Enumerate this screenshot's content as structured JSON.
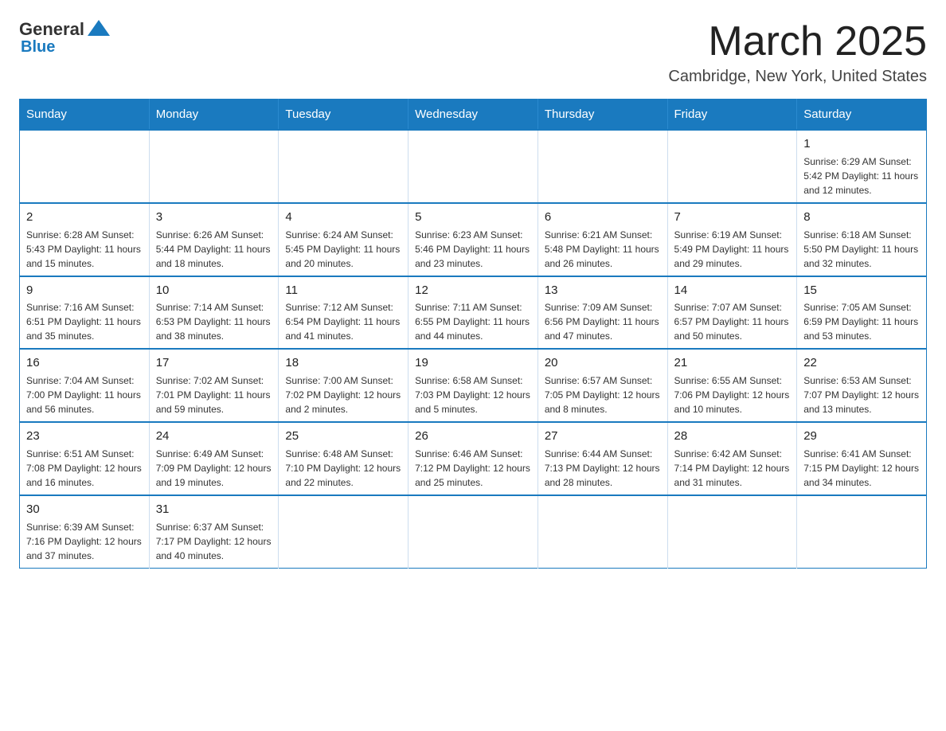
{
  "logo": {
    "general": "General",
    "blue": "Blue"
  },
  "header": {
    "month": "March 2025",
    "location": "Cambridge, New York, United States"
  },
  "weekdays": [
    "Sunday",
    "Monday",
    "Tuesday",
    "Wednesday",
    "Thursday",
    "Friday",
    "Saturday"
  ],
  "weeks": [
    [
      {
        "day": "",
        "info": ""
      },
      {
        "day": "",
        "info": ""
      },
      {
        "day": "",
        "info": ""
      },
      {
        "day": "",
        "info": ""
      },
      {
        "day": "",
        "info": ""
      },
      {
        "day": "",
        "info": ""
      },
      {
        "day": "1",
        "info": "Sunrise: 6:29 AM\nSunset: 5:42 PM\nDaylight: 11 hours and 12 minutes."
      }
    ],
    [
      {
        "day": "2",
        "info": "Sunrise: 6:28 AM\nSunset: 5:43 PM\nDaylight: 11 hours and 15 minutes."
      },
      {
        "day": "3",
        "info": "Sunrise: 6:26 AM\nSunset: 5:44 PM\nDaylight: 11 hours and 18 minutes."
      },
      {
        "day": "4",
        "info": "Sunrise: 6:24 AM\nSunset: 5:45 PM\nDaylight: 11 hours and 20 minutes."
      },
      {
        "day": "5",
        "info": "Sunrise: 6:23 AM\nSunset: 5:46 PM\nDaylight: 11 hours and 23 minutes."
      },
      {
        "day": "6",
        "info": "Sunrise: 6:21 AM\nSunset: 5:48 PM\nDaylight: 11 hours and 26 minutes."
      },
      {
        "day": "7",
        "info": "Sunrise: 6:19 AM\nSunset: 5:49 PM\nDaylight: 11 hours and 29 minutes."
      },
      {
        "day": "8",
        "info": "Sunrise: 6:18 AM\nSunset: 5:50 PM\nDaylight: 11 hours and 32 minutes."
      }
    ],
    [
      {
        "day": "9",
        "info": "Sunrise: 7:16 AM\nSunset: 6:51 PM\nDaylight: 11 hours and 35 minutes."
      },
      {
        "day": "10",
        "info": "Sunrise: 7:14 AM\nSunset: 6:53 PM\nDaylight: 11 hours and 38 minutes."
      },
      {
        "day": "11",
        "info": "Sunrise: 7:12 AM\nSunset: 6:54 PM\nDaylight: 11 hours and 41 minutes."
      },
      {
        "day": "12",
        "info": "Sunrise: 7:11 AM\nSunset: 6:55 PM\nDaylight: 11 hours and 44 minutes."
      },
      {
        "day": "13",
        "info": "Sunrise: 7:09 AM\nSunset: 6:56 PM\nDaylight: 11 hours and 47 minutes."
      },
      {
        "day": "14",
        "info": "Sunrise: 7:07 AM\nSunset: 6:57 PM\nDaylight: 11 hours and 50 minutes."
      },
      {
        "day": "15",
        "info": "Sunrise: 7:05 AM\nSunset: 6:59 PM\nDaylight: 11 hours and 53 minutes."
      }
    ],
    [
      {
        "day": "16",
        "info": "Sunrise: 7:04 AM\nSunset: 7:00 PM\nDaylight: 11 hours and 56 minutes."
      },
      {
        "day": "17",
        "info": "Sunrise: 7:02 AM\nSunset: 7:01 PM\nDaylight: 11 hours and 59 minutes."
      },
      {
        "day": "18",
        "info": "Sunrise: 7:00 AM\nSunset: 7:02 PM\nDaylight: 12 hours and 2 minutes."
      },
      {
        "day": "19",
        "info": "Sunrise: 6:58 AM\nSunset: 7:03 PM\nDaylight: 12 hours and 5 minutes."
      },
      {
        "day": "20",
        "info": "Sunrise: 6:57 AM\nSunset: 7:05 PM\nDaylight: 12 hours and 8 minutes."
      },
      {
        "day": "21",
        "info": "Sunrise: 6:55 AM\nSunset: 7:06 PM\nDaylight: 12 hours and 10 minutes."
      },
      {
        "day": "22",
        "info": "Sunrise: 6:53 AM\nSunset: 7:07 PM\nDaylight: 12 hours and 13 minutes."
      }
    ],
    [
      {
        "day": "23",
        "info": "Sunrise: 6:51 AM\nSunset: 7:08 PM\nDaylight: 12 hours and 16 minutes."
      },
      {
        "day": "24",
        "info": "Sunrise: 6:49 AM\nSunset: 7:09 PM\nDaylight: 12 hours and 19 minutes."
      },
      {
        "day": "25",
        "info": "Sunrise: 6:48 AM\nSunset: 7:10 PM\nDaylight: 12 hours and 22 minutes."
      },
      {
        "day": "26",
        "info": "Sunrise: 6:46 AM\nSunset: 7:12 PM\nDaylight: 12 hours and 25 minutes."
      },
      {
        "day": "27",
        "info": "Sunrise: 6:44 AM\nSunset: 7:13 PM\nDaylight: 12 hours and 28 minutes."
      },
      {
        "day": "28",
        "info": "Sunrise: 6:42 AM\nSunset: 7:14 PM\nDaylight: 12 hours and 31 minutes."
      },
      {
        "day": "29",
        "info": "Sunrise: 6:41 AM\nSunset: 7:15 PM\nDaylight: 12 hours and 34 minutes."
      }
    ],
    [
      {
        "day": "30",
        "info": "Sunrise: 6:39 AM\nSunset: 7:16 PM\nDaylight: 12 hours and 37 minutes."
      },
      {
        "day": "31",
        "info": "Sunrise: 6:37 AM\nSunset: 7:17 PM\nDaylight: 12 hours and 40 minutes."
      },
      {
        "day": "",
        "info": ""
      },
      {
        "day": "",
        "info": ""
      },
      {
        "day": "",
        "info": ""
      },
      {
        "day": "",
        "info": ""
      },
      {
        "day": "",
        "info": ""
      }
    ]
  ]
}
